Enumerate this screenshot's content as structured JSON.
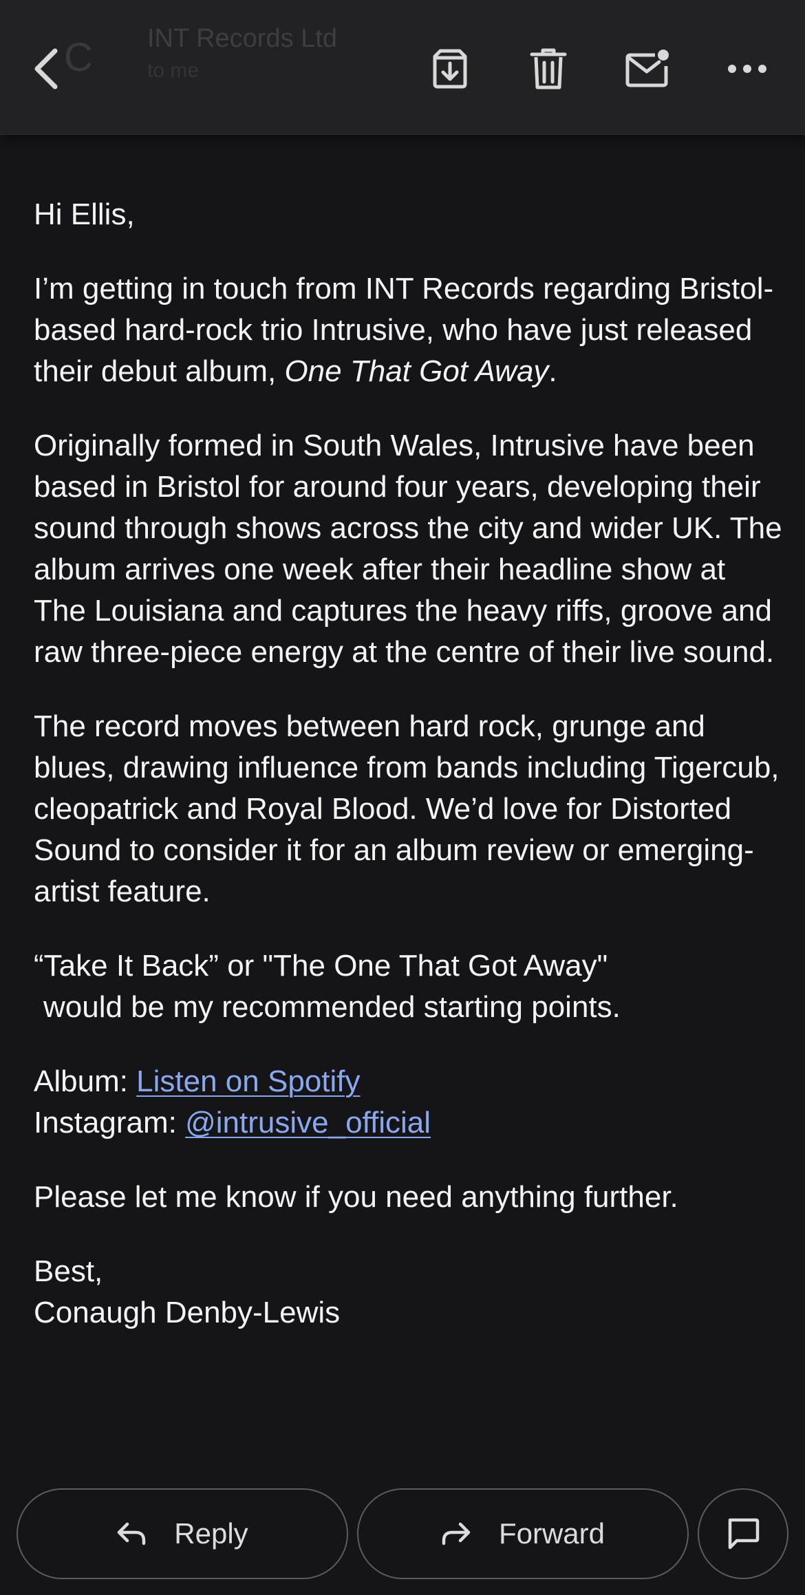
{
  "header": {
    "sender_name": "INT Records Ltd",
    "avatar_letter": "C",
    "sub_line": "to me",
    "icons": {
      "back": "chevron-left-icon",
      "archive": "archive-icon",
      "delete": "trash-icon",
      "mark_unread": "mail-unread-icon",
      "more": "more-horizontal-icon"
    }
  },
  "email": {
    "greeting": "Hi Ellis,",
    "p1": {
      "text": "I’m getting in touch from INT Records regarding Bristol-based hard-rock trio Intrusive, who have just released their debut album, ",
      "album_title": "One That Got Away",
      "end": "."
    },
    "p2": "Originally formed in South Wales, Intrusive have been based in Bristol for around four years, developing their sound through shows across the city and wider UK. The album arrives one week after their headline show at The Louisiana and captures the heavy riffs, groove and raw three-piece energy at the centre of their live sound.",
    "p3": "The record moves between hard rock, grunge and blues, drawing influence from bands including Tigercub, cleopatrick and Royal Blood. We’d love for Distorted Sound to consider it for an album review or emerging-artist feature.",
    "p4_line1": "“Take It Back” or \"The One That Got Away\"",
    "p4_line2": "would be my recommended starting points.",
    "album_label": "Album: ",
    "album_link": "Listen on Spotify",
    "instagram_label": "Instagram: ",
    "instagram_link": "@intrusive_official",
    "p6": "Please let me know if you need anything further.",
    "signoff": "Best,",
    "signature": "Conaugh Denby-Lewis"
  },
  "footer": {
    "reply_label": "Reply",
    "forward_label": "Forward",
    "icons": {
      "reply": "reply-arrow-icon",
      "forward": "forward-arrow-icon",
      "chat": "chat-bubble-icon"
    }
  },
  "colors": {
    "background": "#151517",
    "header": "#222225",
    "text": "#f4f4f4",
    "link": "#8aa8f0",
    "pill_border": "#5b5b60"
  }
}
